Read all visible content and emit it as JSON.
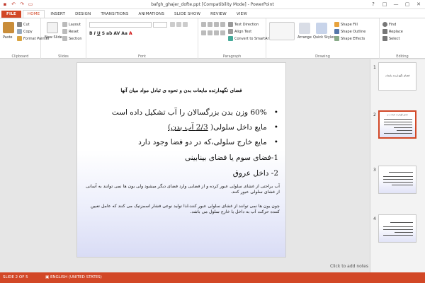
{
  "titlebar": {
    "title": "bafgh_ghajer_dofte.ppt [Compatibility Mode] - PowerPoint",
    "qat": [
      "save-icon",
      "undo-icon",
      "redo-icon",
      "present-icon"
    ],
    "controls": [
      "?",
      "□",
      "—",
      "▢",
      "✕"
    ]
  },
  "tabs": [
    "FILE",
    "HOME",
    "INSERT",
    "DESIGN",
    "TRANSITIONS",
    "ANIMATIONS",
    "SLIDE SHOW",
    "REVIEW",
    "VIEW"
  ],
  "ribbon": {
    "clipboard": {
      "paste": "Paste",
      "cut": "Cut",
      "copy": "Copy",
      "format_painter": "Format Painter",
      "label": "Clipboard"
    },
    "slides": {
      "new_slide": "New Slide",
      "layout": "Layout",
      "reset": "Reset",
      "section": "Section",
      "label": "Slides"
    },
    "font": {
      "label": "Font"
    },
    "paragraph": {
      "text_direction": "Text Direction",
      "align_text": "Align Text",
      "convert_smartart": "Convert to SmartArt",
      "label": "Paragraph"
    },
    "drawing": {
      "arrange": "Arrange",
      "quick_styles": "Quick Styles",
      "shape_fill": "Shape Fill",
      "shape_outline": "Shape Outline",
      "shape_effects": "Shape Effects",
      "label": "Drawing"
    },
    "editing": {
      "find": "Find",
      "replace": "Replace",
      "select": "Select",
      "label": "Editing"
    }
  },
  "slide": {
    "title": "فضای نگهدارنده مایعات بدن و نحوه ی تبادل مواد میان آنها",
    "bullet1": "60% وزن بدن بزرگسالان را آب تشکیل داده است",
    "bullet2_a": "مایع داخل سلولی( ",
    "bullet2_b": "2/3 آب بدن)",
    "bullet3": "مایع خارج سلولی،که در دو فضا وجود دارد",
    "item1": "1-فضای سوم یا فضای بینابینی",
    "item2": "2- داخل عروق",
    "para1": "آب براحتی از غشای سلولی عبور کرده و از فضایی وارد فضای دیگر میشود ولی یون ها نمی توانند به آسانی از غشای سلولی عبور کنند.",
    "para2": "چون یون ها نمی توانند از غشای سلولی عبور کنند،لذا تولید نوعی فشار اسمزتیک می کنند که عامل تعیین کننده حرکت آب به داخل یا خارج سلول می باشد."
  },
  "notes_placeholder": "Click to add notes",
  "thumbnails": [
    {
      "num": "1",
      "title": "فضای نگهدارنده مایعات"
    },
    {
      "num": "2",
      "title": "فضای نگهدارنده مایعات بدن"
    },
    {
      "num": "3",
      "title": ""
    },
    {
      "num": "4",
      "title": ""
    }
  ],
  "status": {
    "slide_info": "SLIDE 2 OF 5",
    "language": "ENGLISH (UNITED STATES)"
  },
  "colors": {
    "accent": "#d24726"
  }
}
